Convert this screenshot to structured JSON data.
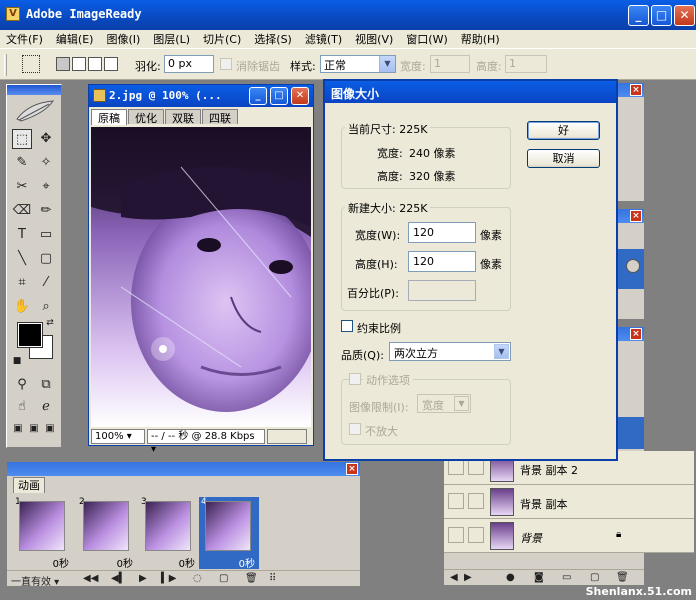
{
  "app": {
    "title": "Adobe ImageReady",
    "logo_glyph": "V",
    "btn_min": "_",
    "btn_max": "□",
    "btn_close": "✕"
  },
  "menu": [
    "文件(F)",
    "编辑(E)",
    "图像(I)",
    "图层(L)",
    "切片(C)",
    "选择(S)",
    "滤镜(T)",
    "视图(V)",
    "窗口(W)",
    "帮助(H)"
  ],
  "options": {
    "feather_label": "羽化:",
    "feather_value": "0 px",
    "antialias_label": "消除锯齿",
    "style_label": "样式:",
    "style_value": "正常",
    "width_label": "宽度:",
    "width_value": "1",
    "height_label": "高度:",
    "height_value": "1"
  },
  "document": {
    "title": "2.jpg @ 100% (...",
    "tabs": [
      "原稿",
      "优化",
      "双联",
      "四联"
    ],
    "zoom": "100%",
    "status": "-- / -- 秒 @ 28.8 Kbps"
  },
  "dialog": {
    "title": "图像大小",
    "current_size_label": "当前尺寸: 225K",
    "current_width_label": "宽度:",
    "current_width_value": "240 像素",
    "current_height_label": "高度:",
    "current_height_value": "320 像素",
    "new_size_label": "新建大小: 225K",
    "width_label": "宽度(W):",
    "width_value": "120",
    "width_unit": "像素",
    "height_label": "高度(H):",
    "height_value": "120",
    "height_unit": "像素",
    "percent_label": "百分比(P):",
    "percent_value": "",
    "constrain_label": "约束比例",
    "quality_label": "品质(Q):",
    "quality_value": "两次立方",
    "action_group_label": "动作选项",
    "fit_label": "图像限制(I):",
    "fit_value": "宽度",
    "no_enlarge_label": "不放大",
    "ok_label": "好",
    "cancel_label": "取消"
  },
  "layers": [
    {
      "name": "背景 副本 2"
    },
    {
      "name": "背景 副本"
    },
    {
      "name": "背景"
    }
  ],
  "animation": {
    "tab_label": "动画",
    "frames": [
      {
        "num": "1",
        "delay": "0秒"
      },
      {
        "num": "2",
        "delay": "0秒"
      },
      {
        "num": "3",
        "delay": "0秒"
      },
      {
        "num": "4",
        "delay": "0秒"
      }
    ],
    "loop_label": "一直有效"
  },
  "watermark": "Shenlanx.51.com"
}
